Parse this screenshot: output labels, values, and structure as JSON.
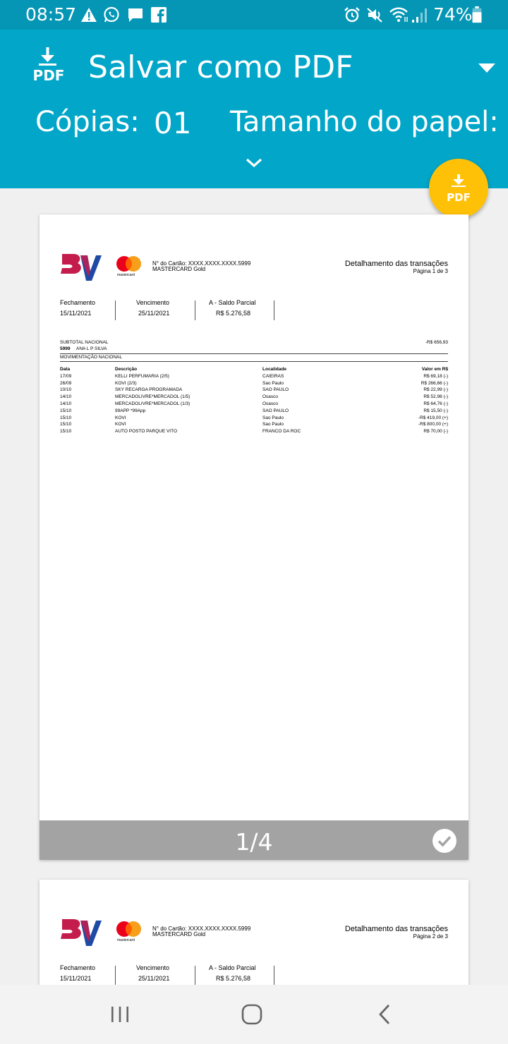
{
  "status_bar": {
    "time": "08:57",
    "battery": "74%",
    "left_icons": [
      "warning-icon",
      "whatsapp-icon",
      "chat-bubble-icon",
      "facebook-icon"
    ],
    "right_icons": [
      "alarm-icon",
      "mute-icon",
      "wifi-icon",
      "signal-icon",
      "battery-icon"
    ]
  },
  "header": {
    "icon_label": "PDF",
    "title": "Salvar como PDF",
    "copies_label": "Cópias:",
    "copies_value": "01",
    "paper_size_label": "Tamanho do papel:",
    "fab_label": "PDF",
    "accent_color": "#02a6c8",
    "fab_color": "#ffc107"
  },
  "document": {
    "card_number": "N° do Cartão: XXXX.XXXX.XXXX.5999",
    "card_type": "MASTERCARD Gold",
    "mastercard_text": "mastercard",
    "title": "Detalhamento das transações",
    "summary": [
      {
        "label": "Fechamento",
        "value": "15/11/2021"
      },
      {
        "label": "Vencimento",
        "value": "25/11/2021"
      },
      {
        "label": "A - Saldo Parcial",
        "value": "R$ 5.276,58"
      }
    ],
    "subtotal_label": "SUBTOTAL NACIONAL",
    "subtotal_value": "-R$ 656,93",
    "card_final": "5999",
    "holder": "ANA L P SILVA",
    "section": "MOVIMENTAÇÃO NACIONAL",
    "columns": [
      "Data",
      "Descrição",
      "Localidade",
      "Valor em R$"
    ],
    "transactions": [
      [
        "17/09",
        "KELLI PERFUMARIA (2/5)",
        "CAIEIRAS",
        "R$ 69,18 (-)"
      ],
      [
        "26/09",
        "KOVI (2/3)",
        "Sao Paulo",
        "R$ 266,66 (-)"
      ],
      [
        "10/10",
        "SKY RECARGA PROGRAMADA",
        "SAO PAULO",
        "R$ 22,99 (-)"
      ],
      [
        "14/10",
        "MERCADOLIVRE*MERCADOL (1/5)",
        "Osasco",
        "R$ 52,98 (-)"
      ],
      [
        "14/10",
        "MERCADOLIVRE*MERCADOL (1/3)",
        "Osasco",
        "R$ 64,76 (-)"
      ],
      [
        "15/10",
        "99APP *99App",
        "SAO PAULO",
        "R$ 15,50 (-)"
      ],
      [
        "15/10",
        "KOVI",
        "Sao Paulo",
        "-R$ 419,00 (+)"
      ],
      [
        "15/10",
        "KOVI",
        "Sao Paulo",
        "-R$ 800,00 (+)"
      ],
      [
        "15/10",
        "AUTO POSTO PARQUE VITO",
        "FRANCO DA ROC",
        "R$ 70,00 (-)"
      ]
    ]
  },
  "pages": [
    {
      "page_label": "Página 1 de 3",
      "indicator": "1/4",
      "selected": true
    },
    {
      "page_label": "Página 2 de 3"
    }
  ]
}
